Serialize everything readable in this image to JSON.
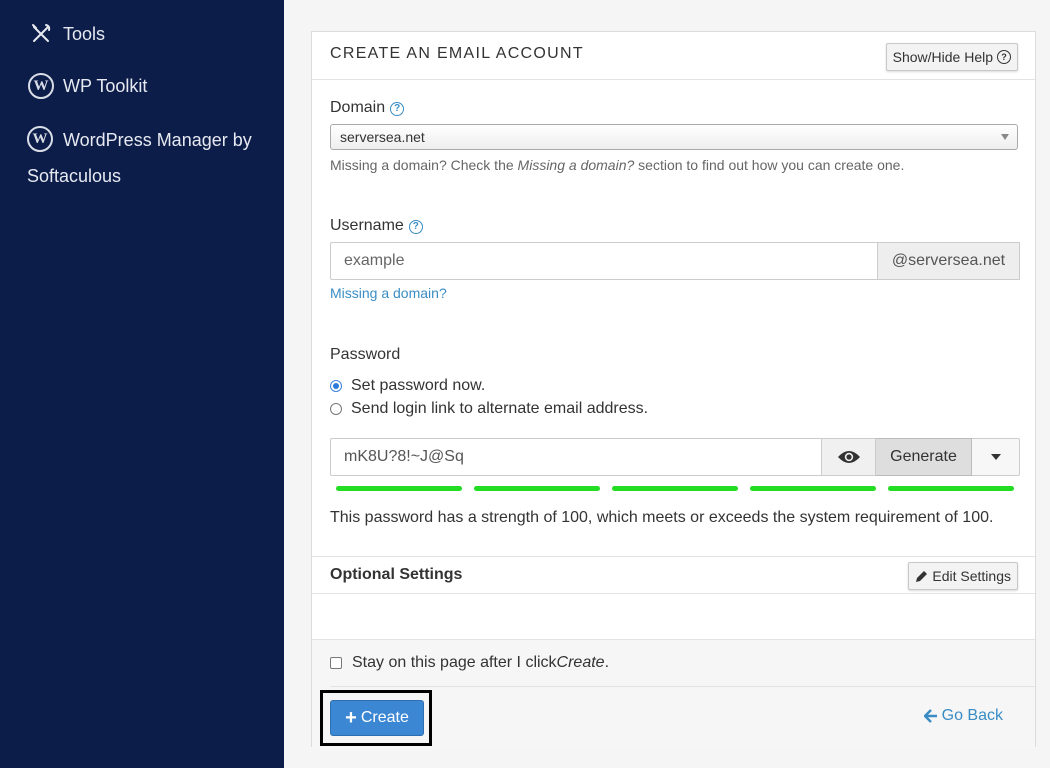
{
  "sidebar": {
    "items": [
      {
        "label": "Tools",
        "icon": "tools-icon"
      },
      {
        "label": "WP Toolkit",
        "icon": "wordpress-icon"
      },
      {
        "label": "WordPress Manager by Softaculous",
        "icon": "wordpress-icon"
      }
    ]
  },
  "panel": {
    "title": "CREATE AN EMAIL ACCOUNT",
    "help_button": "Show/Hide Help",
    "domain": {
      "label": "Domain",
      "value": "serversea.net",
      "hint_prefix": "Missing a domain? Check the ",
      "hint_em": "Missing a domain?",
      "hint_suffix": " section to find out how you can create one."
    },
    "username": {
      "label": "Username",
      "placeholder": "example",
      "suffix": "@serversea.net",
      "missing_link": "Missing a domain?"
    },
    "password": {
      "label": "Password",
      "option_now": "Set password now.",
      "option_link": "Send login link to alternate email address.",
      "value": "mK8U?8!~J@Sq",
      "generate_label": "Generate",
      "strength": 100,
      "strength_text": "This password has a strength of 100, which meets or exceeds the system requirement of 100."
    },
    "optional": {
      "title": "Optional Settings",
      "edit_button": "Edit Settings"
    },
    "footer": {
      "stay_prefix": "Stay on this page after I click ",
      "stay_em": "Create",
      "stay_suffix": ".",
      "create_label": "Create",
      "go_back_label": "Go Back"
    }
  },
  "colors": {
    "sidebar_bg": "#0d1d4a",
    "primary": "#3b87d4",
    "link": "#3a8dc4",
    "strength_bar": "#22dd22"
  }
}
